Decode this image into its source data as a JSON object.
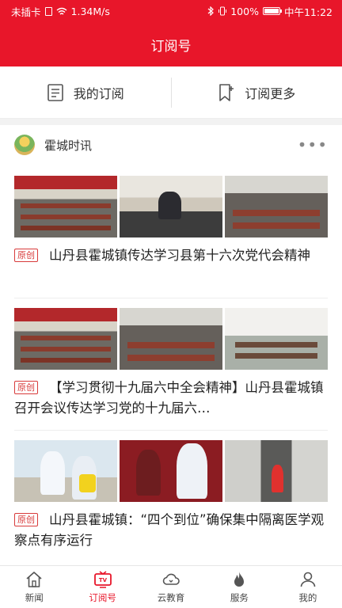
{
  "status_bar": {
    "carrier": "未插卡",
    "network_speed": "1.34M/s",
    "battery": "100%",
    "time": "中午11:22"
  },
  "title_bar": {
    "title": "订阅号"
  },
  "sub_nav": {
    "my_subscriptions": "我的订阅",
    "subscribe_more": "订阅更多"
  },
  "channel": {
    "name": "霍城时讯",
    "more_label": "•••"
  },
  "articles": [
    {
      "badge": "原创",
      "title": "山丹县霍城镇传达学习县第十六次党代会精神",
      "images": [
        "hall",
        "office",
        "meeting"
      ]
    },
    {
      "badge": "原创",
      "title": "【学习贯彻十九届六中全会精神】山丹县霍城镇召开会议传达学习党的十九届六…",
      "images": [
        "hall",
        "meeting",
        "room"
      ]
    },
    {
      "badge": "原创",
      "title": "山丹县霍城镇：“四个到位”确保集中隔离医学观察点有序运行",
      "images": [
        "medic",
        "medic2",
        "corridor"
      ]
    }
  ],
  "tab_bar": {
    "tabs": [
      {
        "label": "新闻",
        "icon": "home-icon"
      },
      {
        "label": "订阅号",
        "icon": "tv-icon",
        "active": true
      },
      {
        "label": "云教育",
        "icon": "cloud-icon"
      },
      {
        "label": "服务",
        "icon": "flame-icon"
      },
      {
        "label": "我的",
        "icon": "user-icon"
      }
    ]
  },
  "colors": {
    "brand_red": "#e8162a",
    "badge_red": "#d83a3a"
  }
}
